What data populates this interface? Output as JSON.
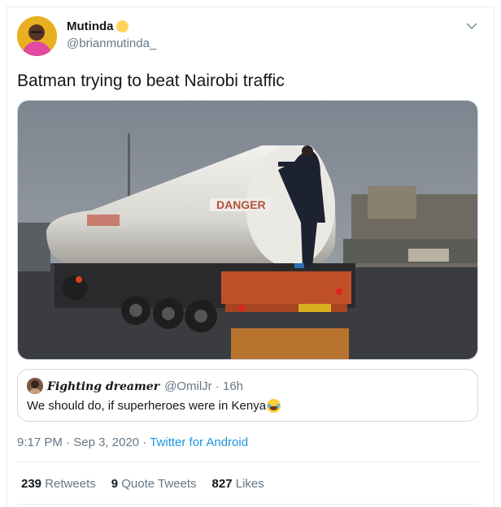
{
  "author": {
    "display_name": "Mutinda",
    "handle": "@brianmutinda_",
    "badge_icon": "sun-emoji-icon"
  },
  "tweet": {
    "text": "Batman trying to beat Nairobi traffic",
    "media_alt_icon": "video-thumbnail"
  },
  "quote": {
    "name": "Fighting dreamer",
    "handle": "@OmilJr",
    "separator": " · ",
    "time": "16h",
    "text": "We should do, if superheroes were in Kenya",
    "emoji_icon": "tears-of-joy-emoji-icon"
  },
  "meta": {
    "time": "9:17 PM",
    "separator1": " · ",
    "date": "Sep 3, 2020",
    "separator2": " · ",
    "source": "Twitter for Android"
  },
  "stats": [
    {
      "count": "239",
      "label": "Retweets"
    },
    {
      "count": "9",
      "label": "Quote Tweets"
    },
    {
      "count": "827",
      "label": "Likes"
    }
  ],
  "colors": {
    "link": "#1b95e0",
    "secondary_text": "#657786",
    "border": "#ccd6dd"
  },
  "media_text": {
    "tanker_label": "DANGER"
  }
}
